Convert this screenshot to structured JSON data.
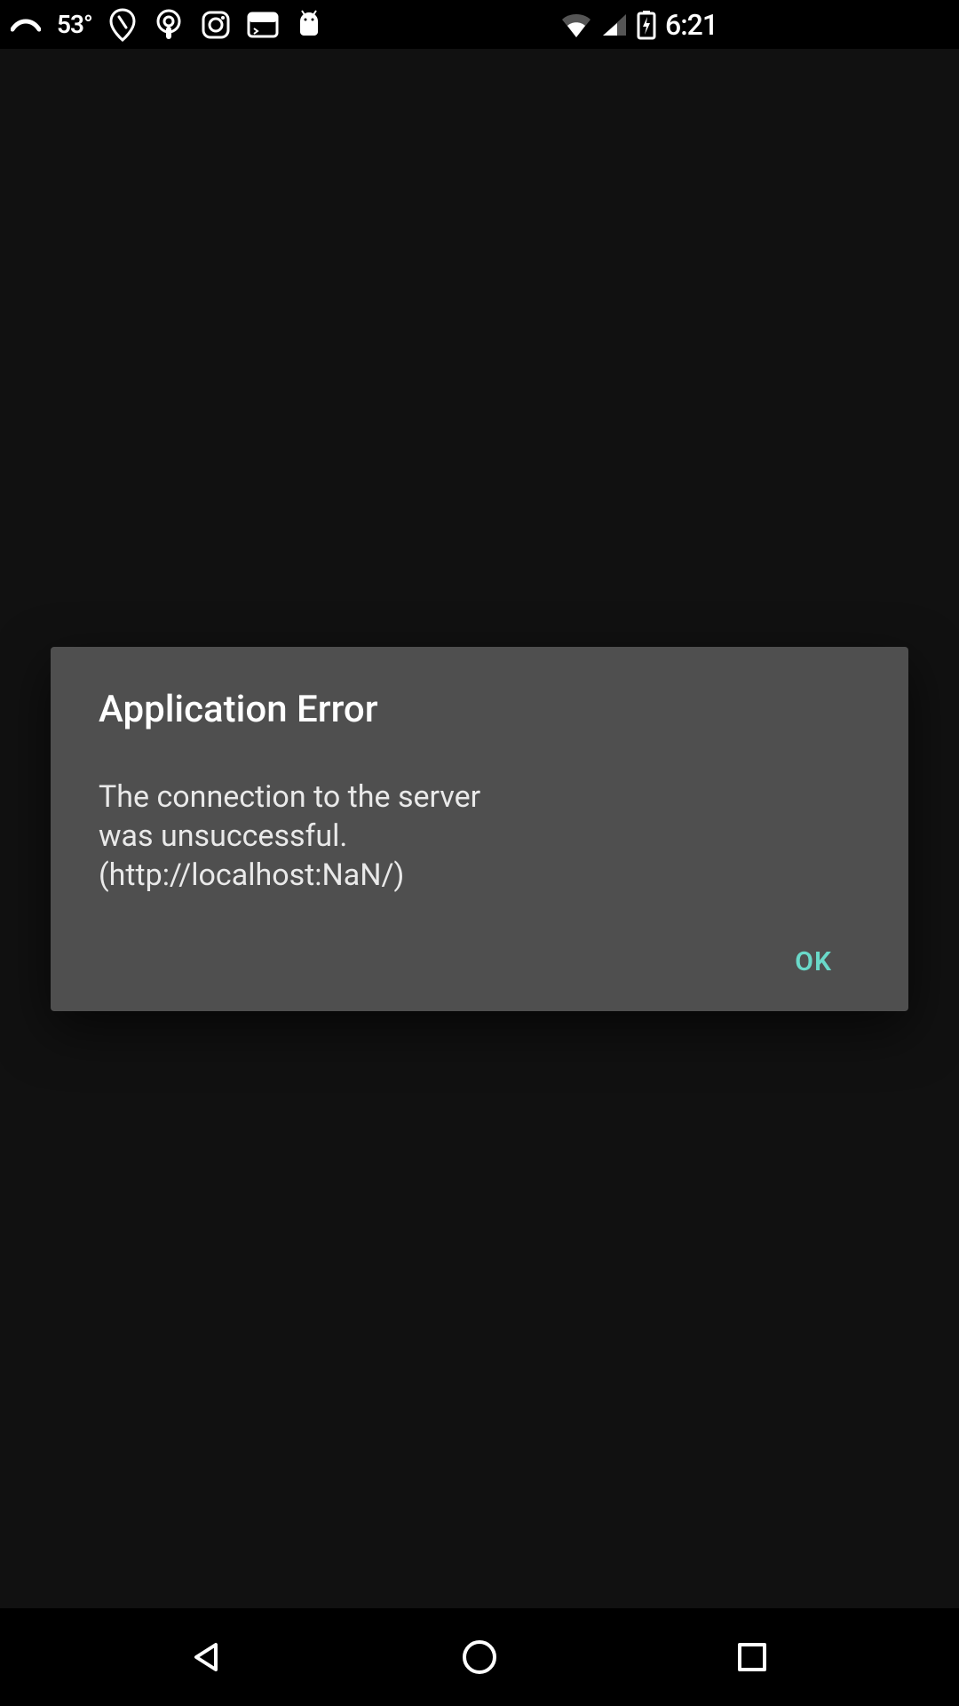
{
  "status_bar": {
    "temperature": "53°",
    "time": "6:21",
    "icons_left": [
      "curve-icon",
      "location-icon",
      "podcast-icon",
      "instagram-icon",
      "terminal-icon",
      "android-icon"
    ],
    "icons_right": [
      "wifi-icon",
      "cell-signal-icon",
      "battery-charging-icon"
    ]
  },
  "dialog": {
    "title": "Application Error",
    "message": "The connection to the server was unsuccessful. (http://localhost:NaN/)",
    "ok_label": "OK"
  },
  "colors": {
    "accent": "#6ad9c9",
    "dialog_bg": "#4f4f4f",
    "app_bg": "#111111"
  }
}
